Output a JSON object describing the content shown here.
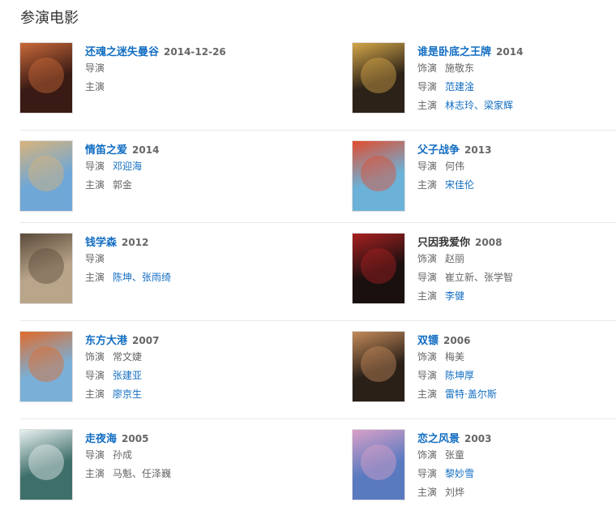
{
  "section_title": "参演电影",
  "colors": {
    "link": "#136ec2",
    "text": "#333333",
    "muted": "#666666",
    "divider": "#e8e8e8"
  },
  "movies": [
    {
      "title": "还魂之迷失曼谷",
      "year": "2014-12-26",
      "title_link": true,
      "roles": [
        {
          "label": "导演",
          "people": ""
        },
        {
          "label": "主演",
          "people": ""
        }
      ]
    },
    {
      "title": "谁是卧底之王牌",
      "year": "2014",
      "title_link": true,
      "roles": [
        {
          "label": "饰演",
          "people": "施敬东",
          "link": false
        },
        {
          "label": "导演",
          "people": "范建淦",
          "link": true
        },
        {
          "label": "主演",
          "people": "林志玲、梁家辉",
          "link": true
        }
      ]
    },
    {
      "title": "情笛之爱",
      "year": "2014",
      "title_link": true,
      "roles": [
        {
          "label": "导演",
          "people": "邓迎海",
          "link": true
        },
        {
          "label": "主演",
          "people": "郭金",
          "link": false
        }
      ]
    },
    {
      "title": "父子战争",
      "year": "2013",
      "title_link": true,
      "roles": [
        {
          "label": "导演",
          "people": "何伟",
          "link": false
        },
        {
          "label": "主演",
          "people": "宋佳伦",
          "link": true
        }
      ]
    },
    {
      "title": "钱学森",
      "year": "2012",
      "title_link": true,
      "roles": [
        {
          "label": "导演",
          "people": ""
        },
        {
          "label": "主演",
          "people": "陈坤、张雨绮",
          "link": true
        }
      ]
    },
    {
      "title": "只因我爱你",
      "year": "2008",
      "title_link": false,
      "roles": [
        {
          "label": "饰演",
          "people": "赵丽",
          "link": false
        },
        {
          "label": "导演",
          "people": "崔立新、张学智",
          "link": false
        },
        {
          "label": "主演",
          "people": "李健",
          "link": true
        }
      ]
    },
    {
      "title": "东方大港",
      "year": "2007",
      "title_link": true,
      "roles": [
        {
          "label": "饰演",
          "people": "常文婕",
          "link": false
        },
        {
          "label": "导演",
          "people": "张建亚",
          "link": true
        },
        {
          "label": "主演",
          "people": "廖京生",
          "link": true
        }
      ]
    },
    {
      "title": "双镖",
      "year": "2006",
      "title_link": true,
      "roles": [
        {
          "label": "饰演",
          "people": "梅美",
          "link": false
        },
        {
          "label": "导演",
          "people": "陈坤厚",
          "link": true
        },
        {
          "label": "主演",
          "people": "雷特·盖尔斯",
          "link": true
        }
      ]
    },
    {
      "title": "走夜海",
      "year": "2005",
      "title_link": true,
      "roles": [
        {
          "label": "导演",
          "people": "孙成",
          "link": false
        },
        {
          "label": "主演",
          "people": "马魁、任泽巍",
          "link": false
        }
      ]
    },
    {
      "title": "恋之风景",
      "year": "2003",
      "title_link": true,
      "roles": [
        {
          "label": "饰演",
          "people": "张童",
          "link": false
        },
        {
          "label": "导演",
          "people": "黎妙雪",
          "link": true
        },
        {
          "label": "主演",
          "people": "刘烨",
          "link": false
        }
      ]
    }
  ],
  "posters": [
    {
      "icon": "poster-image",
      "bg": "#3a1a14",
      "accent": "#c96a3a"
    },
    {
      "icon": "poster-image",
      "bg": "#2d2218",
      "accent": "#d4a74a"
    },
    {
      "icon": "poster-image",
      "bg": "#6fa7d6",
      "accent": "#d9b37a"
    },
    {
      "icon": "poster-image",
      "bg": "#6cb2d8",
      "accent": "#e24c2e"
    },
    {
      "icon": "poster-image",
      "bg": "#b9a58a",
      "accent": "#5b4a3a"
    },
    {
      "icon": "poster-image",
      "bg": "#1a1010",
      "accent": "#a82020"
    },
    {
      "icon": "poster-image",
      "bg": "#7ab0d8",
      "accent": "#e06a2a"
    },
    {
      "icon": "poster-image",
      "bg": "#2a2018",
      "accent": "#c48a5a"
    },
    {
      "icon": "poster-image",
      "bg": "#3f6f6a",
      "accent": "#e8f0f0"
    },
    {
      "icon": "poster-image",
      "bg": "#5a7ac0",
      "accent": "#d9a0c8"
    }
  ]
}
